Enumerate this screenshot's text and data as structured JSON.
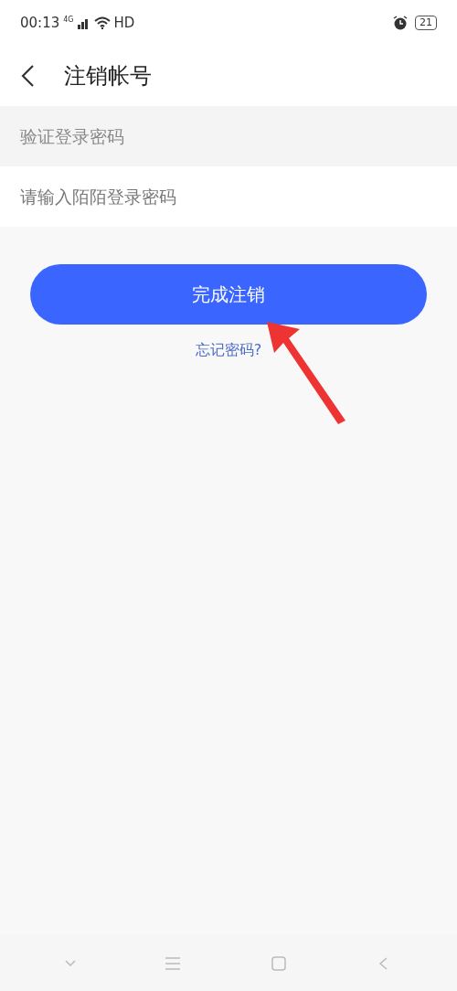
{
  "status_bar": {
    "time": "00:13",
    "network": "4G",
    "hd": "HD",
    "battery": "21"
  },
  "header": {
    "title": "注销帐号"
  },
  "section_label": "验证登录密码",
  "password_field": {
    "placeholder": "请输入陌陌登录密码"
  },
  "submit_button": "完成注销",
  "forgot_link": "忘记密码?"
}
